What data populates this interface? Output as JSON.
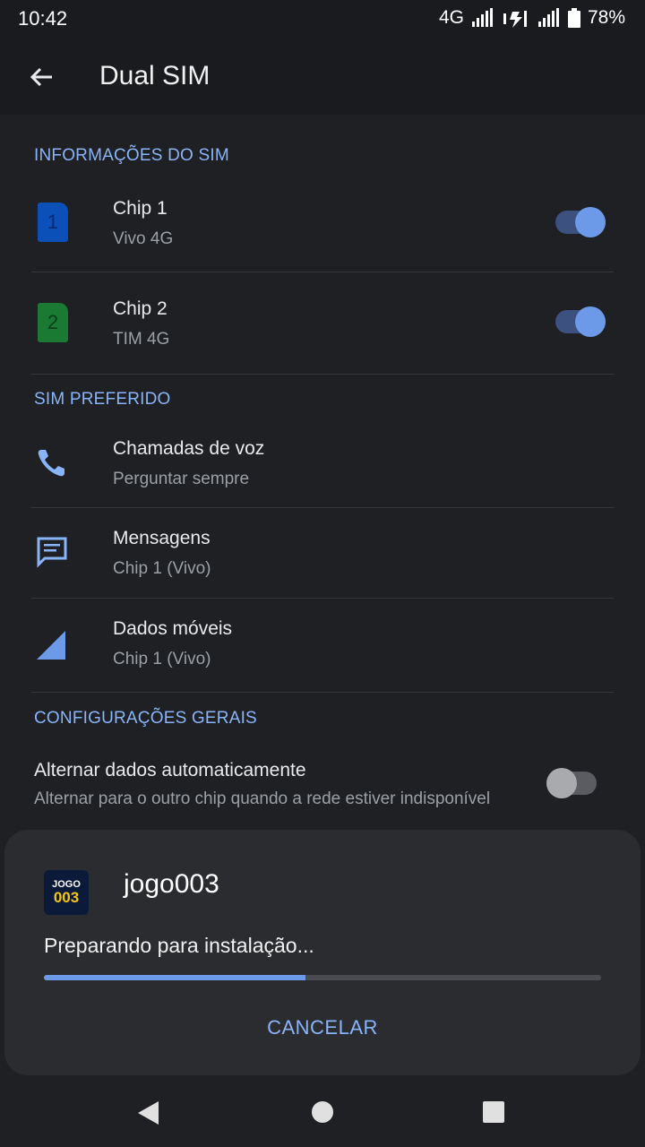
{
  "status": {
    "time": "10:42",
    "network": "4G",
    "battery": "78%"
  },
  "appbar": {
    "title": "Dual SIM"
  },
  "sim_info": {
    "header": "INFORMAÇÕES DO SIM",
    "chips": [
      {
        "number": "1",
        "title": "Chip 1",
        "subtitle": "Vivo 4G",
        "enabled": true,
        "color": "#0b4fb8"
      },
      {
        "number": "2",
        "title": "Chip 2",
        "subtitle": "TIM 4G",
        "enabled": true,
        "color": "#1a7a34"
      }
    ]
  },
  "preferred": {
    "header": "SIM PREFERIDO",
    "items": [
      {
        "icon": "phone-icon",
        "title": "Chamadas de voz",
        "subtitle": "Perguntar sempre"
      },
      {
        "icon": "message-icon",
        "title": "Mensagens",
        "subtitle": "Chip 1 (Vivo)"
      },
      {
        "icon": "signal-icon",
        "title": "Dados móveis",
        "subtitle": "Chip 1 (Vivo)"
      }
    ]
  },
  "general": {
    "header": "CONFIGURAÇÕES GERAIS",
    "auto_switch": {
      "title": "Alternar dados automaticamente",
      "subtitle": "Alternar para o outro chip quando a rede estiver indisponível",
      "enabled": false
    }
  },
  "install_sheet": {
    "logo_top": "JOGO",
    "logo_bottom": "003",
    "app_name": "jogo003",
    "message": "Preparando para instalação...",
    "progress": 0.47,
    "cancel_label": "CANCELAR"
  },
  "colors": {
    "accent": "#8ab4f8",
    "toggle_on": "#6d9ae8",
    "background": "#1f2024"
  }
}
